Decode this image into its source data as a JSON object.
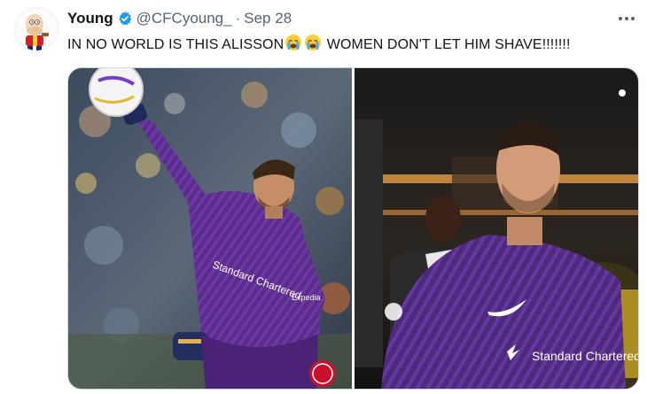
{
  "tweet": {
    "display_name": "Young",
    "handle": "@CFCyoung_",
    "separator": "·",
    "date": "Sep 28",
    "text_part1": "IN NO WORLD IS THIS ALISSON",
    "text_part2": " WOMEN DON'T LET HIM SHAVE!!!!!!!",
    "emoji": [
      "loudly-crying-face",
      "loudly-crying-face"
    ]
  },
  "media": {
    "photos": [
      {
        "description_icon": "goalkeeper-throw-photo",
        "shirt_sponsor": "Standard Chartered",
        "sleeve_sponsor": "Expedia"
      },
      {
        "description_icon": "tunnel-walkout-photo",
        "shirt_sponsor": "Standard Chartered"
      }
    ]
  },
  "colors": {
    "verified": "#1d9bf0",
    "muted": "#536471",
    "kit_purple": "#5b2d8c"
  }
}
